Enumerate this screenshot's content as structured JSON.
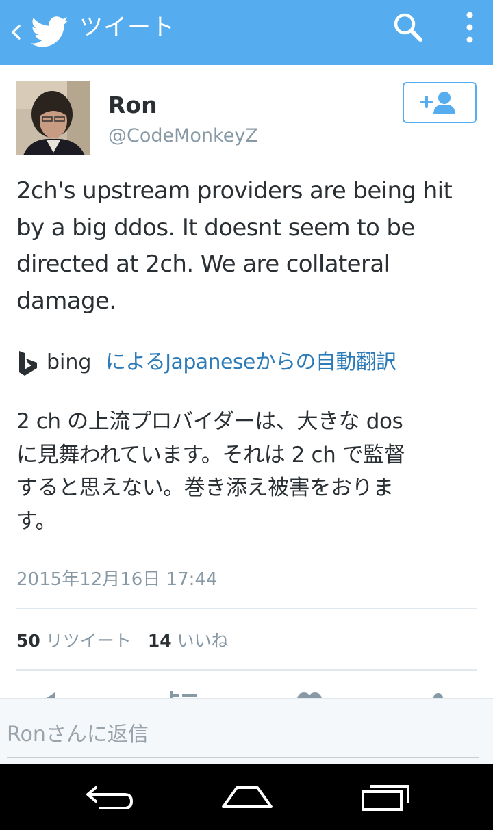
{
  "appbar": {
    "title": "ツイート",
    "icons": {
      "back": "chevron-left-icon",
      "logo": "twitter-bird-icon",
      "search": "search-icon",
      "overflow": "overflow-menu-icon"
    },
    "color": "#55acee"
  },
  "tweet": {
    "user_name": "Ron",
    "user_handle": "@CodeMonkeyZ",
    "follow_icon": "follow-user-icon",
    "text": "2ch's upstream providers are being hit\nby a big ddos. It doesnt seem to be\ndirected at 2ch. We are collateral\ndamage.",
    "translation_provider": "bing",
    "translation_label": "によるJapaneseからの自動翻訳",
    "translated_text": "2 ch の上流プロバイダーは、大きな dos\nに見舞われています。それは 2 ch で監督\nすると思えない。巻き添え被害をおりま\nす。",
    "timestamp": "2015年12月16日 17:44",
    "retweet_count": "50",
    "retweet_label": "リツイート",
    "like_count": "14",
    "like_label": "いいね"
  },
  "actions": {
    "icons": [
      "reply-icon",
      "retweet-icon",
      "like-icon",
      "share-icon"
    ]
  },
  "reply": {
    "placeholder": "Ronさんに返信",
    "value": ""
  },
  "navbar": {
    "icons": [
      "back-nav-icon",
      "home-nav-icon",
      "recents-nav-icon"
    ]
  },
  "colors": {
    "accent": "#55acee",
    "link": "#2b7bb9",
    "text": "#292f33",
    "muted": "#8899a6"
  }
}
